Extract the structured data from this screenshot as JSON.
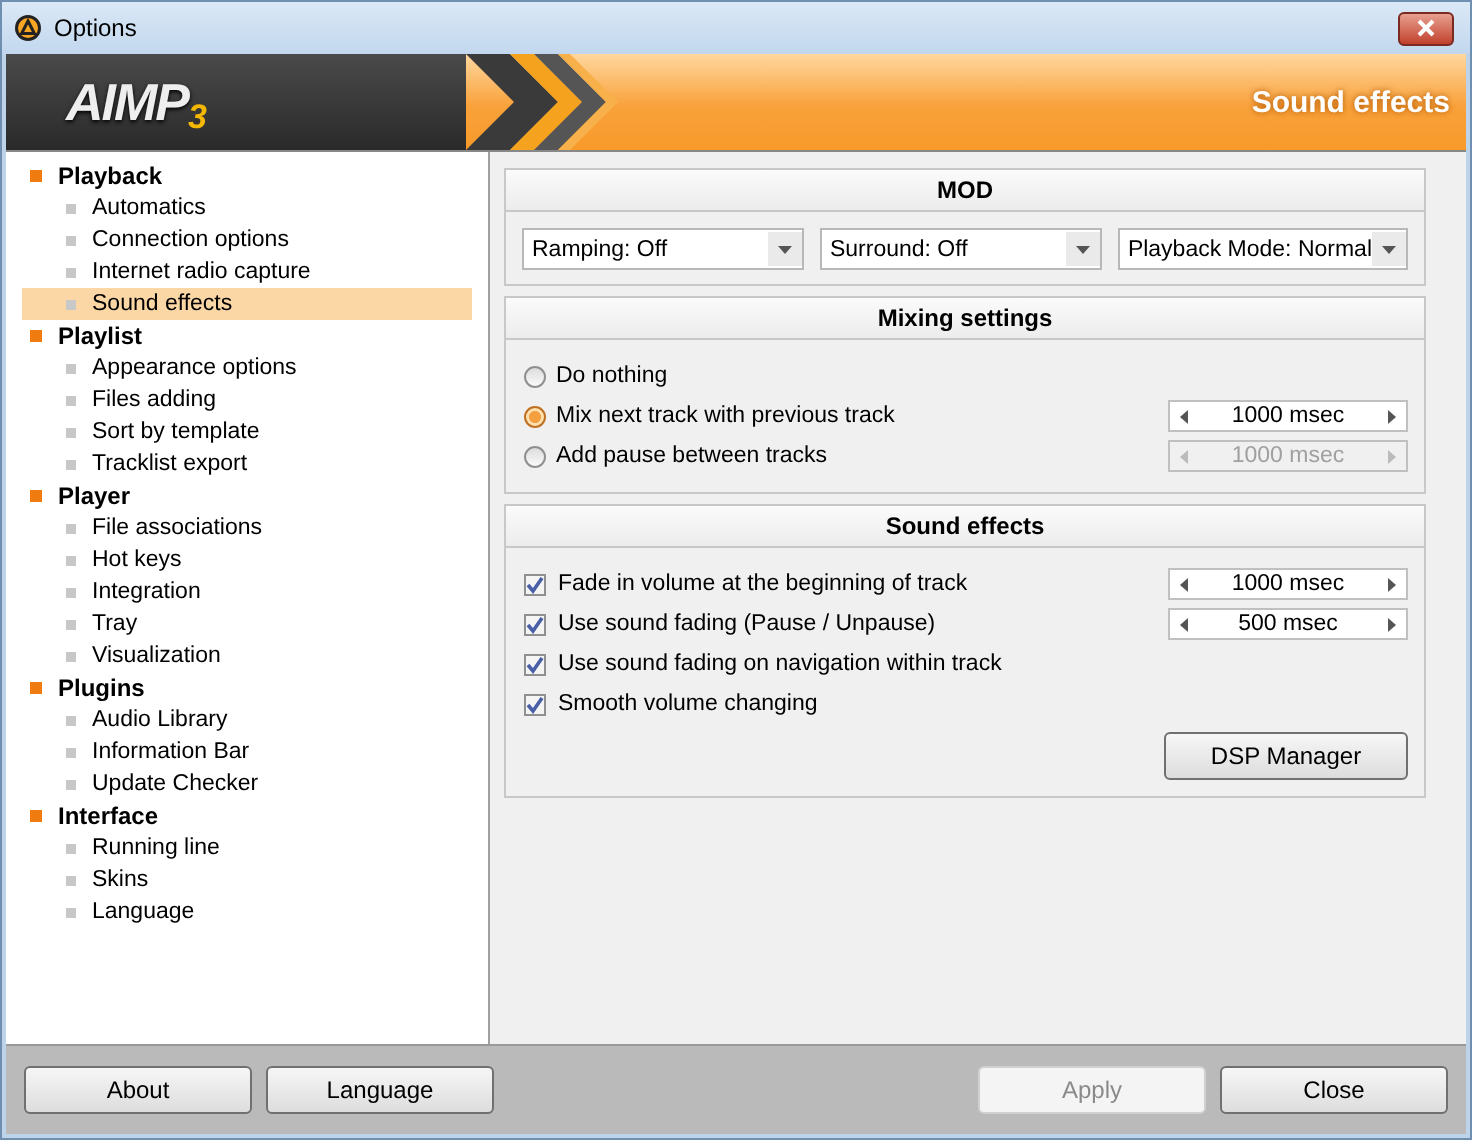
{
  "window": {
    "title": "Options"
  },
  "header": {
    "logo": "AIMP",
    "logo_version": "3",
    "title": "Sound effects"
  },
  "sidebar": {
    "items": [
      {
        "label": "Playback",
        "children": [
          {
            "label": "Automatics",
            "selected": false
          },
          {
            "label": "Connection options",
            "selected": false
          },
          {
            "label": "Internet radio capture",
            "selected": false
          },
          {
            "label": "Sound effects",
            "selected": true
          }
        ]
      },
      {
        "label": "Playlist",
        "children": [
          {
            "label": "Appearance options",
            "selected": false
          },
          {
            "label": "Files adding",
            "selected": false
          },
          {
            "label": "Sort by template",
            "selected": false
          },
          {
            "label": "Tracklist export",
            "selected": false
          }
        ]
      },
      {
        "label": "Player",
        "children": [
          {
            "label": "File associations",
            "selected": false
          },
          {
            "label": "Hot keys",
            "selected": false
          },
          {
            "label": "Integration",
            "selected": false
          },
          {
            "label": "Tray",
            "selected": false
          },
          {
            "label": "Visualization",
            "selected": false
          }
        ]
      },
      {
        "label": "Plugins",
        "children": [
          {
            "label": "Audio Library",
            "selected": false
          },
          {
            "label": "Information Bar",
            "selected": false
          },
          {
            "label": "Update Checker",
            "selected": false
          }
        ]
      },
      {
        "label": "Interface",
        "children": [
          {
            "label": "Running line",
            "selected": false
          },
          {
            "label": "Skins",
            "selected": false
          },
          {
            "label": "Language",
            "selected": false
          }
        ]
      }
    ]
  },
  "mod": {
    "title": "MOD",
    "dropdowns": [
      "Ramping: Off",
      "Surround: Off",
      "Playback Mode: Normal"
    ]
  },
  "mixing": {
    "title": "Mixing settings",
    "options": [
      {
        "label": "Do nothing",
        "selected": false
      },
      {
        "label": "Mix next track with previous track",
        "selected": true,
        "spinner": {
          "value": "1000 msec",
          "disabled": false
        }
      },
      {
        "label": "Add pause between tracks",
        "selected": false,
        "spinner": {
          "value": "1000 msec",
          "disabled": true
        }
      }
    ]
  },
  "effects": {
    "title": "Sound effects",
    "options": [
      {
        "label": "Fade in volume at the beginning of track",
        "checked": true,
        "spinner": {
          "value": "1000 msec",
          "disabled": false
        }
      },
      {
        "label": "Use sound fading (Pause / Unpause)",
        "checked": true,
        "spinner": {
          "value": "500 msec",
          "disabled": false
        }
      },
      {
        "label": "Use sound fading on navigation within track",
        "checked": true
      },
      {
        "label": "Smooth volume changing",
        "checked": true
      }
    ],
    "button": "DSP Manager"
  },
  "footer": {
    "left_buttons": [
      {
        "label": "About",
        "disabled": false
      },
      {
        "label": "Language",
        "disabled": false
      }
    ],
    "right_buttons": [
      {
        "label": "Apply",
        "disabled": true
      },
      {
        "label": "Close",
        "disabled": false
      }
    ]
  }
}
